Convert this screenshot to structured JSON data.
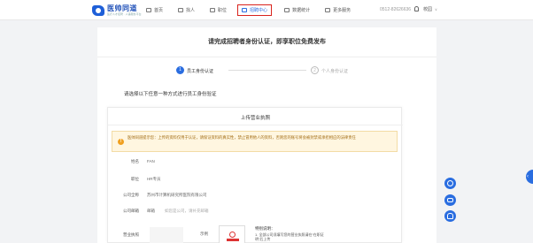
{
  "header": {
    "logo_title": "医帅同道",
    "logo_sub": "医疗人才招聘 · 人事服务平台",
    "nav": [
      {
        "label": "首页"
      },
      {
        "label": "找人"
      },
      {
        "label": "职位"
      },
      {
        "label": "招聘中心"
      },
      {
        "label": "数据统计"
      },
      {
        "label": "更多服务"
      }
    ],
    "phone": "0512-82626636",
    "campus": "校园",
    "campus_caret": "∨"
  },
  "page": {
    "headline": "请完成招聘者身份认证，即享职位免费发布",
    "steps": [
      {
        "num": "1",
        "label": "员工身份认证"
      },
      {
        "num": "2",
        "label": "个人身份认证"
      }
    ],
    "choose_text": "请选择以下任意一种方式进行员工身份验证"
  },
  "form": {
    "title": "上传营业执照",
    "notice_icon": "!",
    "notice": "医帅同道提示您：上传的资料仅用于认证，请保证资料的真实性，禁止冒用他人的资料，否则您的账号将会被封禁或承担相应的法律责任",
    "fields": {
      "name_label": "姓名",
      "name_value": "FAN",
      "position_label": "职位",
      "position_value": "HR专员",
      "company_label": "公司全称",
      "company_value": "苏州市计算机研究所医院有限公司",
      "email_label": "公司邮箱",
      "email_value": "邮箱",
      "email_placeholder": "如您是公司，请补充邮箱",
      "license_label": "营业执照"
    },
    "example_label": "示例",
    "tips_title": "特别说明：",
    "tips_text": "1. 全部公司须填写您的营业执照请在“在职证明”后上传"
  },
  "side": {
    "toggle": "‹"
  },
  "icons": [
    "home-icon",
    "people-icon",
    "briefcase-icon",
    "recruit-center-icon",
    "chart-icon",
    "grid-icon",
    "bell-icon",
    "warning-icon",
    "link-icon",
    "chat-icon",
    "headset-icon"
  ],
  "colors": {
    "primary": "#2a6de0",
    "highlight_border": "#d9231d",
    "notice_bg": "#fff6e0",
    "notice_text": "#a06a10"
  }
}
